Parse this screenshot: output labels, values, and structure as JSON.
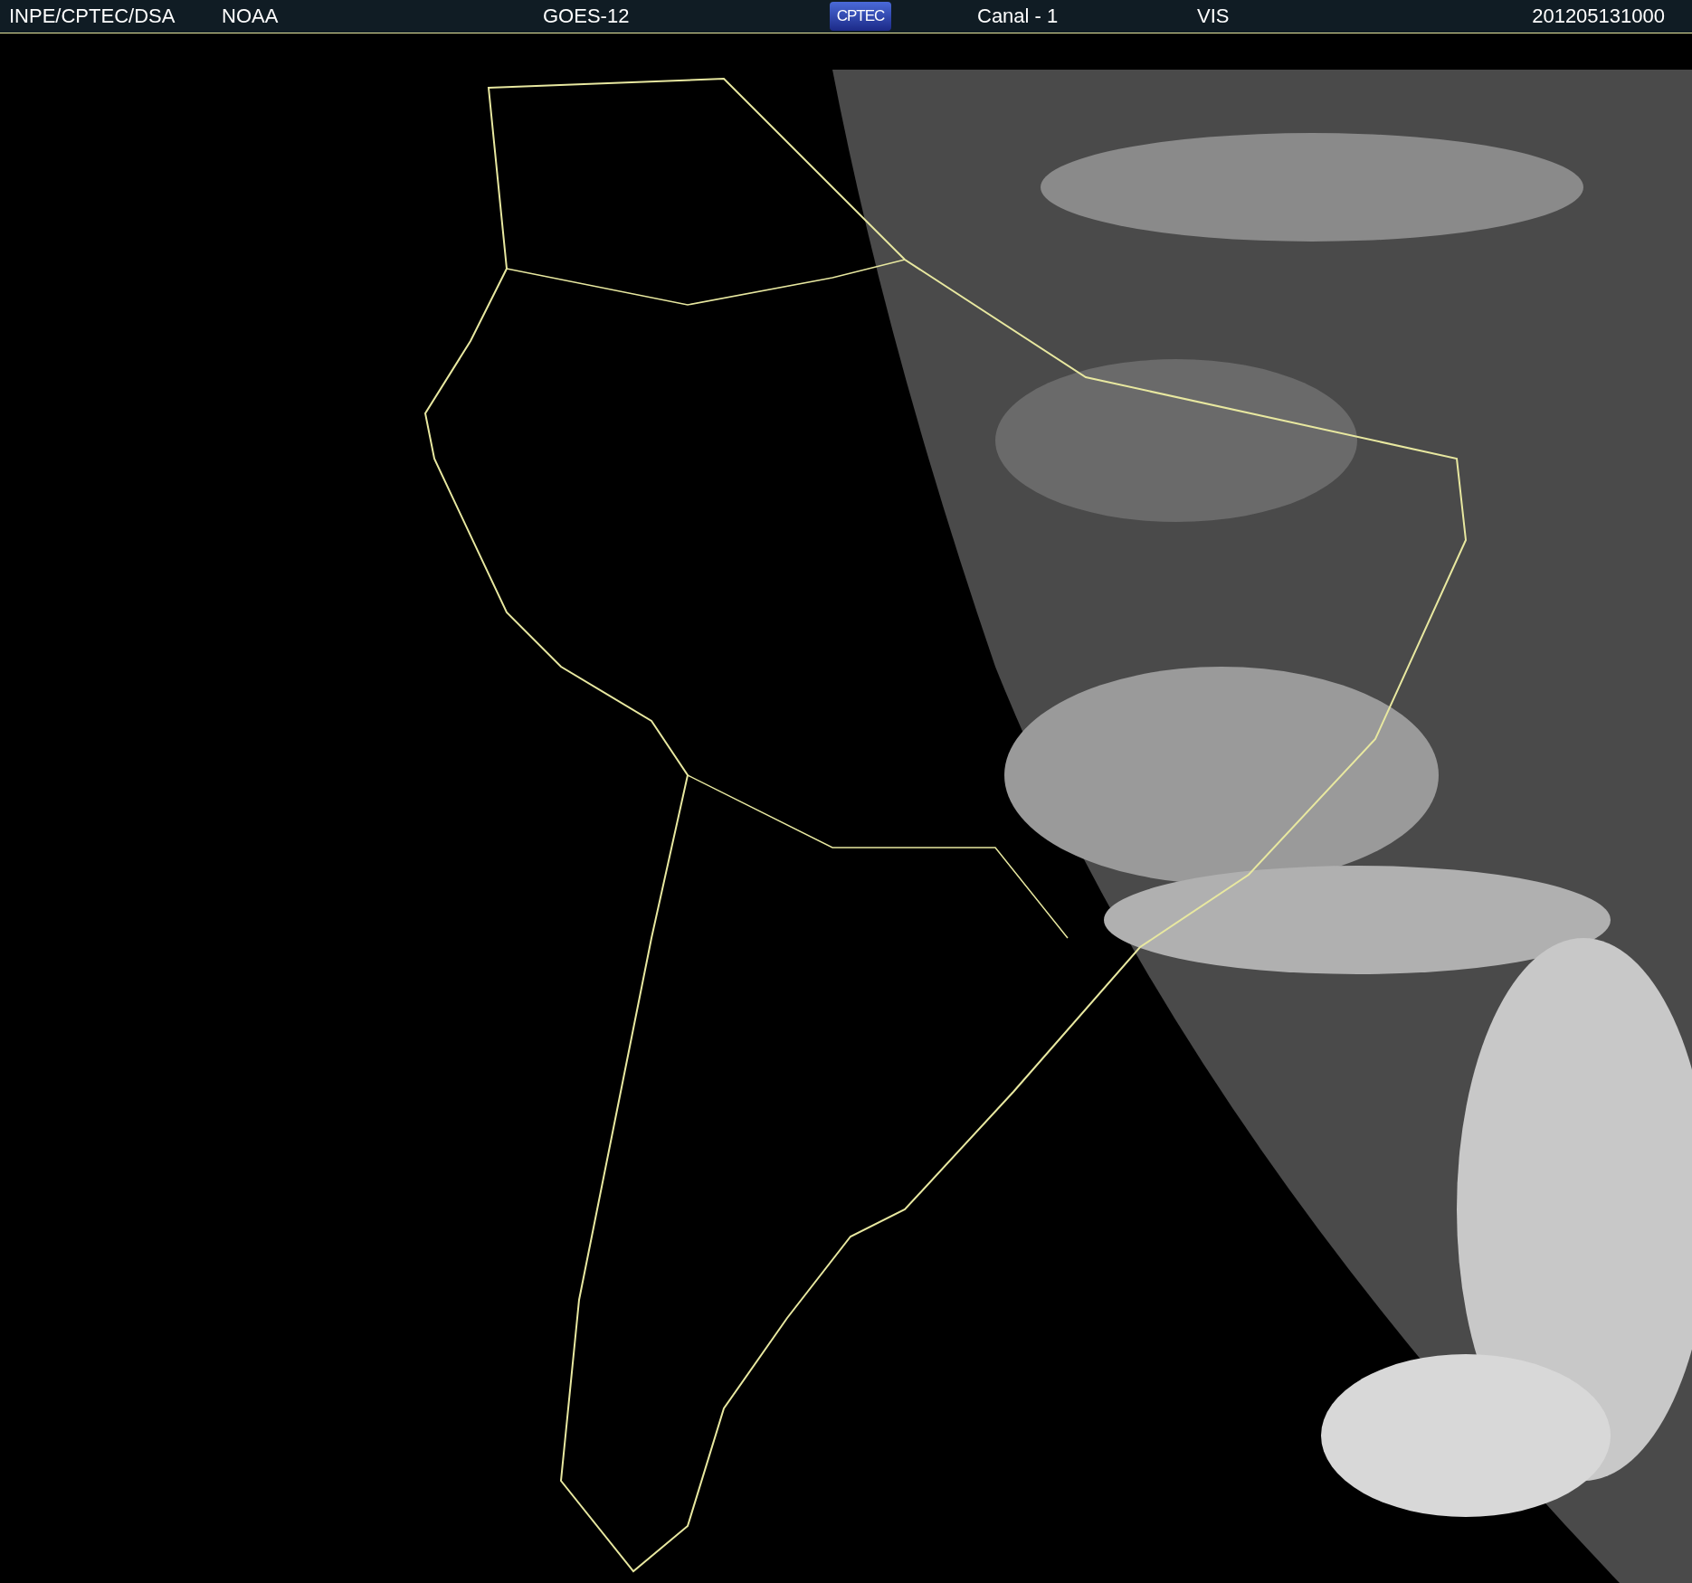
{
  "header": {
    "source": "INPE/CPTEC/DSA",
    "agency": "NOAA",
    "satellite": "GOES-12",
    "logo": "CPTEC",
    "channel": "Canal - 1",
    "band": "VIS",
    "timestamp": "201205131000"
  }
}
